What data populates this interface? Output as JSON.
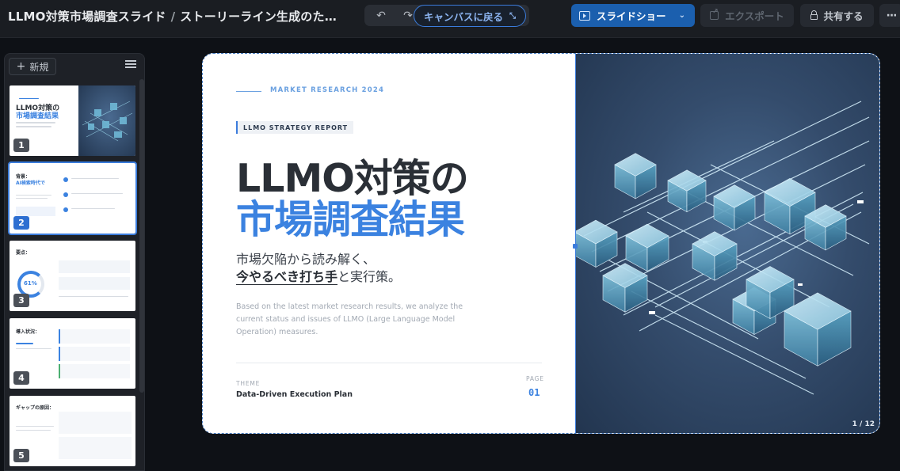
{
  "header": {
    "doc_title": "LLMO対策市場調査スライド",
    "separator": "/",
    "page_title": "ストーリーライン生成のた…",
    "back_to_canvas": "キャンバスに戻る",
    "slideshow": "スライドショー",
    "export": "エクスポート",
    "share": "共有する",
    "more": "···"
  },
  "sidebar": {
    "new_label": "新規",
    "thumbnails": [
      {
        "number": "1",
        "title_a": "LLMO対策の",
        "title_b": "市場調査結果"
      },
      {
        "number": "2",
        "title_a": "背景：",
        "title_b": "AI検索時代で"
      },
      {
        "number": "3",
        "title_a": "要点：",
        "title_b": "61%"
      },
      {
        "number": "4",
        "title_a": "導入状況：",
        "title_b": ""
      },
      {
        "number": "5",
        "title_a": "ギャップの原因：",
        "title_b": ""
      }
    ]
  },
  "slide": {
    "kicker": "MARKET RESEARCH 2024",
    "tag": "LLMO STRATEGY REPORT",
    "title_line1": "LLMO対策の",
    "title_line2": "市場調査結果",
    "subtitle_line1": "市場欠陥から読み解く、",
    "subtitle_emphasis": "今やるべき打ち手",
    "subtitle_tail": "と実行策。",
    "description": "Based on the latest market research results, we analyze the current status and issues of LLMO (Large Language Model Operation) measures.",
    "theme_label": "THEME",
    "theme_value": "Data-Driven Execution Plan",
    "page_label": "PAGE",
    "page_value": "01",
    "page_count": "1 / 12"
  },
  "colors": {
    "accent": "#3b82e0",
    "topbar_bg": "#1a1d22",
    "canvas_bg": "#0e1116",
    "primary_button": "#1b5fae"
  }
}
